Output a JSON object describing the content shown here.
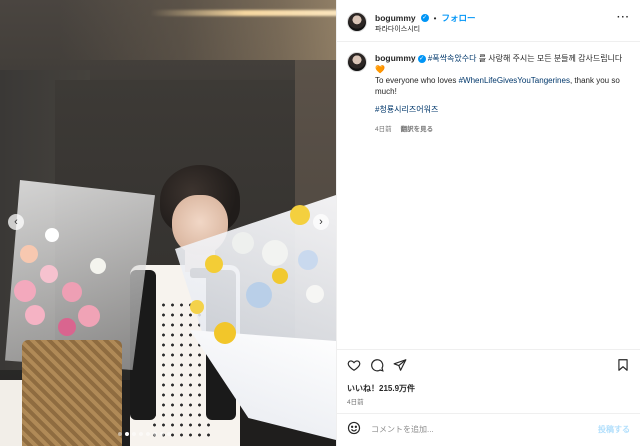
{
  "header": {
    "username": "bogummy",
    "separator": "•",
    "follow_label": "フォロー",
    "location": "파라다이스시티",
    "more_label": "···"
  },
  "caption": {
    "username": "bogummy",
    "line1_tag": "#폭싹속았수다",
    "line1_text": " 를 사랑해 주시는 모든 분들께 감사드립니다🧡",
    "line2_text_a": "To everyone who loves ",
    "line2_tag": "#WhenLifeGivesYouTangerines",
    "line2_text_b": ", thank you so much!",
    "line3_tag": "#청룡시리즈어워즈",
    "age": "4日前",
    "see_translation": "翻訳を見る"
  },
  "actions": {
    "like_icon": "heart-icon",
    "comment_icon": "comment-icon",
    "share_icon": "share-icon",
    "save_icon": "bookmark-icon"
  },
  "stats": {
    "likes": "いいね！215.9万件",
    "time": "4日前"
  },
  "comment": {
    "placeholder": "コメントを追加...",
    "post_label": "投稿する",
    "emoji_icon": "smile-icon"
  },
  "carousel": {
    "prev_icon": "chevron-left-icon",
    "next_icon": "chevron-right-icon",
    "slide_count": 8,
    "active_index": 1
  },
  "colors": {
    "accent": "#0095f6",
    "link": "#00376b",
    "muted": "#737373",
    "post_disabled": "#b2dffc"
  }
}
